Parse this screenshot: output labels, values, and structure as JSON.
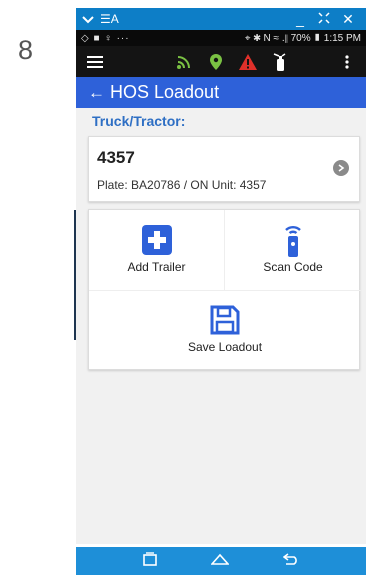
{
  "step_number": "8",
  "window": {
    "app_name": "☰A",
    "minimize": "_",
    "restore": "✕",
    "close": "✕"
  },
  "status": {
    "left": "◇ ■ ♀ ···",
    "right": "⌖ ✱ N ≈ .∥ 70% ▮ 1:15 PM"
  },
  "toolbar": {
    "icons": [
      "menu-icon",
      "signal-icon",
      "location-pin-icon",
      "warning-icon",
      "fire-extinguisher-icon",
      "overflow-menu-icon"
    ],
    "colors": {
      "signal": "#7ac143",
      "pin": "#7ac143",
      "warning": "#e0302a",
      "extinguisher": "#ffffff"
    }
  },
  "appbar": {
    "back": "←",
    "title": "HOS Loadout"
  },
  "truck": {
    "section_label": "Truck/Tractor:",
    "number": "4357",
    "details": "Plate: BA20786 / ON Unit: 4357"
  },
  "actions": {
    "add_trailer": "Add Trailer",
    "scan_code": "Scan Code",
    "save_loadout": "Save Loadout"
  },
  "colors": {
    "accent": "#2e61d9",
    "title_bar": "#0d7ec7",
    "nav_bar": "#1e8fd8",
    "section_label": "#2e6fc4"
  }
}
